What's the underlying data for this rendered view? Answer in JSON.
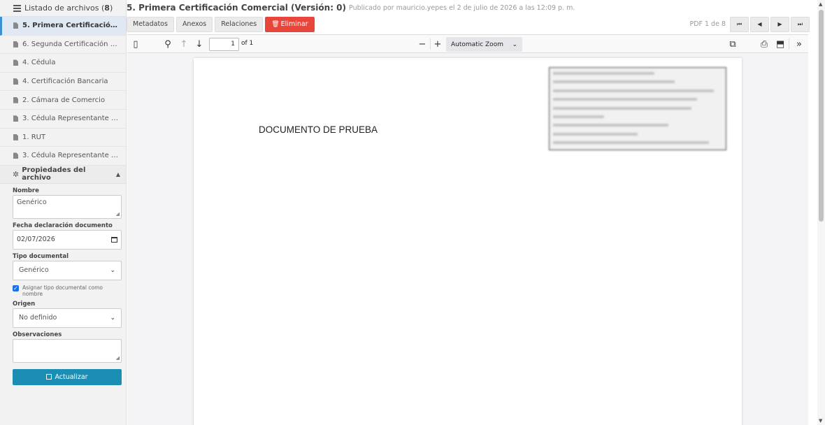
{
  "sidebar": {
    "header_label": "Listado de archivos",
    "header_count": "8",
    "items": [
      {
        "label": "5. Primera Certificación Co..."
      },
      {
        "label": "6. Segunda Certificación Co..."
      },
      {
        "label": "4. Cédula"
      },
      {
        "label": "4. Certificación Bancaria"
      },
      {
        "label": "2. Cámara de Comercio"
      },
      {
        "label": "3. Cédula Representante Legal"
      },
      {
        "label": "1. RUT"
      },
      {
        "label": "3. Cédula Representante Legal"
      }
    ]
  },
  "properties": {
    "title": "Propiedades del archivo",
    "nombre_label": "Nombre",
    "nombre_value": "Genérico",
    "fecha_label": "Fecha declaración documento",
    "fecha_value": "02/07/2026",
    "tipo_label": "Tipo documental",
    "tipo_value": "Genérico",
    "asignar_label": "Asignar tipo documental como nombre",
    "asignar_checked": true,
    "origen_label": "Origen",
    "origen_value": "No definido",
    "observaciones_label": "Observaciones",
    "observaciones_value": "",
    "update_label": "Actualizar"
  },
  "header": {
    "title": "5. Primera Certificación Comercial (Versión: 0)",
    "published": "Publicado por mauricio.yepes el 2 de julio de 2026 a las 12:09 p. m."
  },
  "tabs": {
    "metadatos": "Metadatos",
    "anexos": "Anexos",
    "relaciones": "Relaciones",
    "eliminar": "Eliminar"
  },
  "pager": {
    "text": "PDF 1 de 8"
  },
  "viewer": {
    "page_number": "1",
    "page_total": "of 1",
    "zoom": "Automatic Zoom",
    "document_text": "DOCUMENTO DE PRUEBA"
  },
  "colors": {
    "accent": "#1a8fb3",
    "danger": "#e8463b",
    "active_item_bg": "#dfe8f3"
  }
}
